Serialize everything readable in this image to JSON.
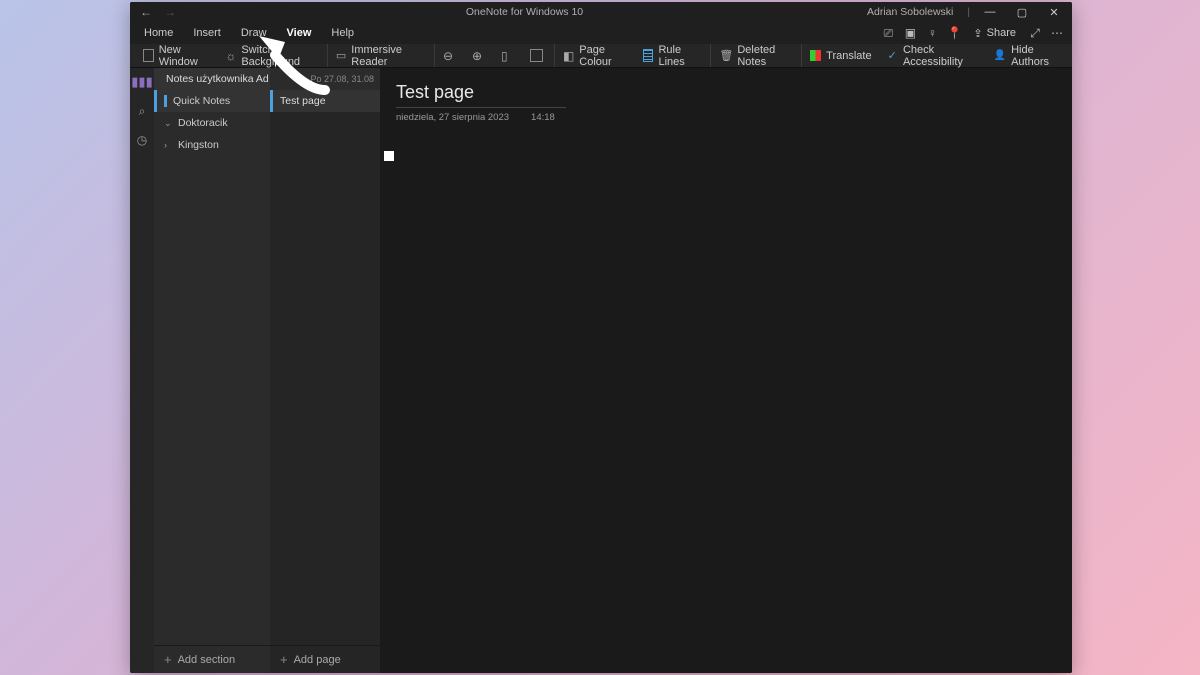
{
  "app_title": "OneNote for Windows 10",
  "user_name": "Adrian Sobolewski",
  "menu": {
    "home": "Home",
    "insert": "Insert",
    "draw": "Draw",
    "view": "View",
    "help": "Help",
    "share": "Share"
  },
  "ribbon": {
    "new_window": "New Window",
    "switch_bg": "Switch Background",
    "immersive": "Immersive Reader",
    "page_colour": "Page Colour",
    "rule_lines": "Rule Lines",
    "deleted_notes": "Deleted Notes",
    "translate": "Translate",
    "check_access": "Check Accessibility",
    "hide_authors": "Hide Authors"
  },
  "notebook": {
    "header_label": "Notes użytkownika Ad…",
    "sections": {
      "quick_notes": "Quick Notes",
      "doktoracik": "Doktoracik",
      "kingston": "Kingston"
    },
    "add_section": "Add section"
  },
  "pages": {
    "meta": "Po 27.08, 31.08",
    "test_page": "Test page",
    "add_page": "Add page"
  },
  "canvas": {
    "title": "Test page",
    "date": "niedziela, 27 sierpnia 2023",
    "time": "14:18"
  }
}
